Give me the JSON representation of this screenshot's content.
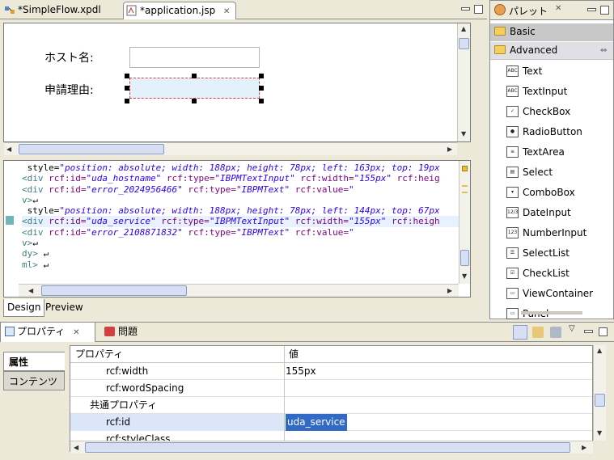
{
  "editor": {
    "tabs": [
      {
        "label": "*SimpleFlow.xpdl",
        "active": false
      },
      {
        "label": "*application.jsp",
        "active": true
      }
    ]
  },
  "design": {
    "host_label": "ホスト名:",
    "reason_label": "申請理由:"
  },
  "source": {
    "lines": [
      [
        [
          "plain",
          " style="
        ],
        [
          "val",
          "\"position: absolute; width: 188px; height: 78px; left: 163px; top: 19px"
        ]
      ],
      [
        [
          "tag",
          "<div "
        ],
        [
          "attr",
          "rcf:id="
        ],
        [
          "val",
          "\"uda_hostname\""
        ],
        [
          "attr",
          " rcf:type="
        ],
        [
          "val",
          "\"IBPMTextInput\""
        ],
        [
          "attr",
          " rcf:width="
        ],
        [
          "val",
          "\"155px\""
        ],
        [
          "attr",
          " rcf:heig"
        ]
      ],
      [
        [
          "tag",
          "<div "
        ],
        [
          "attr",
          "rcf:id="
        ],
        [
          "val",
          "\"error_2024956466\""
        ],
        [
          "attr",
          " rcf:type="
        ],
        [
          "val",
          "\"IBPMText\""
        ],
        [
          "attr",
          " rcf:value="
        ],
        [
          "val",
          "\""
        ]
      ],
      [
        [
          "tag",
          "v>"
        ],
        [
          "plain",
          "↵"
        ]
      ],
      [
        [
          "plain",
          " style="
        ],
        [
          "val",
          "\"position: absolute; width: 188px; height: 78px; left: 144px; top: 67px"
        ]
      ],
      [
        [
          "tag",
          "<div "
        ],
        [
          "attr",
          "rcf:id="
        ],
        [
          "val",
          "\"uda_service\""
        ],
        [
          "attr",
          " rcf:type="
        ],
        [
          "val",
          "\"IBPMTextInput\""
        ],
        [
          "attr",
          " rcf:width="
        ],
        [
          "val",
          "\"155px\""
        ],
        [
          "attr",
          " rcf:heigh"
        ]
      ],
      [
        [
          "tag",
          "<div "
        ],
        [
          "attr",
          "rcf:id="
        ],
        [
          "val",
          "\"error_2108871832\""
        ],
        [
          "attr",
          " rcf:type="
        ],
        [
          "val",
          "\"IBPMText\""
        ],
        [
          "attr",
          " rcf:value="
        ],
        [
          "val",
          "\""
        ]
      ],
      [
        [
          "tag",
          "v>"
        ],
        [
          "plain",
          "↵"
        ]
      ],
      [
        [
          "tag",
          "dy>"
        ],
        [
          "plain",
          " ↵"
        ]
      ],
      [
        [
          "tag",
          "ml>"
        ],
        [
          "plain",
          " ↵"
        ]
      ]
    ],
    "bottom_tabs": [
      "Design",
      "Preview"
    ]
  },
  "palette": {
    "title": "パレット",
    "drawers": [
      "Basic",
      "Advanced"
    ],
    "items": [
      {
        "label": "Text",
        "icon": "ABC"
      },
      {
        "label": "TextInput",
        "icon": "ABC"
      },
      {
        "label": "CheckBox",
        "icon": "✓"
      },
      {
        "label": "RadioButton",
        "icon": "●"
      },
      {
        "label": "TextArea",
        "icon": "≡"
      },
      {
        "label": "Select",
        "icon": "▤"
      },
      {
        "label": "ComboBox",
        "icon": "▾"
      },
      {
        "label": "DateInput",
        "icon": "12/3"
      },
      {
        "label": "NumberInput",
        "icon": "123"
      },
      {
        "label": "SelectList",
        "icon": "☰"
      },
      {
        "label": "CheckList",
        "icon": "☑"
      },
      {
        "label": "ViewContainer",
        "icon": "▭"
      },
      {
        "label": "Panel",
        "icon": "▭"
      }
    ]
  },
  "properties": {
    "tabs": [
      "プロパティ",
      "問題"
    ],
    "side_tabs": [
      "属性",
      "コンテンツ"
    ],
    "columns": [
      "プロパティ",
      "値"
    ],
    "rows": [
      {
        "name": "rcf:width",
        "value": "155px",
        "indent": 2
      },
      {
        "name": "rcf:wordSpacing",
        "value": "",
        "indent": 2
      },
      {
        "name": "共通プロパティ",
        "value": "",
        "indent": 1
      },
      {
        "name": "rcf:id",
        "value": "uda_service",
        "indent": 2,
        "selected": true
      },
      {
        "name": "rcf:styleClass",
        "value": "",
        "indent": 2
      }
    ]
  }
}
